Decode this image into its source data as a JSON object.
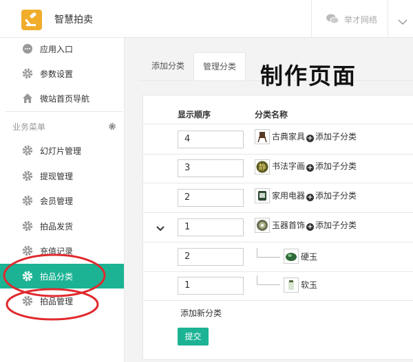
{
  "header": {
    "app_title": "智慧拍卖",
    "brand_text": "举才网络",
    "logo_icon": "gavel-icon",
    "accent": "#f0ad2c"
  },
  "sidebar": {
    "top_items": [
      {
        "label": "应用入口",
        "icon": "chat-icon"
      },
      {
        "label": "参数设置",
        "icon": "gear-icon"
      },
      {
        "label": "微站首页导航",
        "icon": "home-icon"
      }
    ],
    "menu_header": "业务菜单",
    "items": [
      {
        "label": "幻灯片管理",
        "icon": "gear-icon"
      },
      {
        "label": "提现管理",
        "icon": "gear-icon"
      },
      {
        "label": "会员管理",
        "icon": "gear-icon"
      },
      {
        "label": "拍品发货",
        "icon": "gear-icon"
      },
      {
        "label": "充值记录",
        "icon": "gear-icon"
      },
      {
        "label": "拍品分类",
        "icon": "gear-icon",
        "active": true
      },
      {
        "label": "拍品管理",
        "icon": "gear-icon"
      }
    ],
    "active_color": "#1bb394"
  },
  "tabs": [
    {
      "label": "添加分类"
    },
    {
      "label": "管理分类",
      "active": true
    }
  ],
  "overlay_title": "制作页面",
  "table": {
    "headers": {
      "order": "显示顺序",
      "name": "分类名称"
    },
    "rows": [
      {
        "order": "4",
        "name": "古典家具",
        "add_label": "添加子分类",
        "level": 0
      },
      {
        "order": "3",
        "name": "书法字画",
        "add_label": "添加子分类",
        "level": 0
      },
      {
        "order": "2",
        "name": "家用电器",
        "add_label": "添加子分类",
        "level": 0
      },
      {
        "order": "1",
        "name": "玉器首饰",
        "add_label": "添加子分类",
        "level": 0,
        "expanded": true
      },
      {
        "order": "2",
        "name": "硬玉",
        "level": 1
      },
      {
        "order": "1",
        "name": "软玉",
        "level": 1
      }
    ],
    "add_new": "添加新分类",
    "submit": "提交"
  },
  "annotation_color": "#e0292e"
}
